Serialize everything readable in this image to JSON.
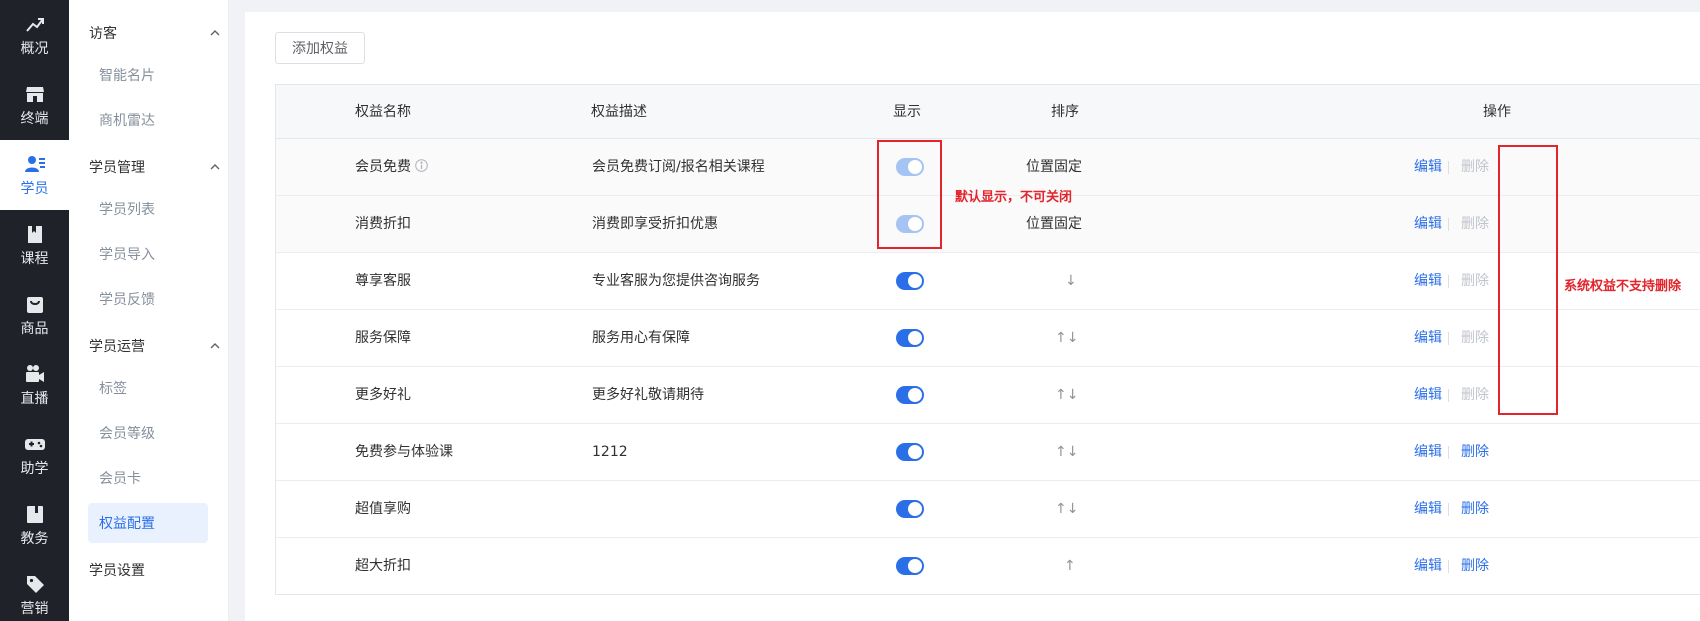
{
  "rail": [
    {
      "label": "概况",
      "icon": "chart-up-icon"
    },
    {
      "label": "终端",
      "icon": "store-icon"
    },
    {
      "label": "学员",
      "icon": "users-icon",
      "active": true
    },
    {
      "label": "课程",
      "icon": "book-icon"
    },
    {
      "label": "商品",
      "icon": "bag-icon"
    },
    {
      "label": "直播",
      "icon": "video-camera-icon"
    },
    {
      "label": "助学",
      "icon": "gamepad-icon"
    },
    {
      "label": "教务",
      "icon": "notebook-icon"
    },
    {
      "label": "营销",
      "icon": "tag-icon"
    }
  ],
  "submenu": {
    "groups": [
      "访客",
      "学员管理",
      "学员运营"
    ],
    "visitor_items": [
      "智能名片",
      "商机雷达"
    ],
    "manage_items": [
      "学员列表",
      "学员导入",
      "学员反馈"
    ],
    "ops_items": [
      "标签",
      "会员等级",
      "会员卡",
      "权益配置"
    ],
    "settings": "学员设置"
  },
  "toolbar": {
    "add_label": "添加权益"
  },
  "table": {
    "headers": [
      "权益名称",
      "权益描述",
      "显示",
      "排序",
      "操作"
    ],
    "rows": [
      {
        "name": "会员免费",
        "desc": "会员免费订阅/报名相关课程",
        "sort": "位置固定",
        "edit": "编辑",
        "delete": "删除"
      },
      {
        "name": "消费折扣",
        "desc": "消费即享受折扣优惠",
        "sort": "位置固定",
        "edit": "编辑",
        "delete": "删除"
      },
      {
        "name": "尊享客服",
        "desc": "专业客服为您提供咨询服务",
        "sort": "↓",
        "edit": "编辑",
        "delete": "删除"
      },
      {
        "name": "服务保障",
        "desc": "服务用心有保障",
        "sort": "↑↓",
        "edit": "编辑",
        "delete": "删除"
      },
      {
        "name": "更多好礼",
        "desc": "更多好礼敬请期待",
        "sort": "↑↓",
        "edit": "编辑",
        "delete": "删除"
      },
      {
        "name": "免费参与体验课",
        "desc": "1212",
        "sort": "↑↓",
        "edit": "编辑",
        "delete": "删除"
      },
      {
        "name": "超值享购",
        "desc": "",
        "sort": "↑↓",
        "edit": "编辑",
        "delete": "删除"
      },
      {
        "name": "超大折扣",
        "desc": "",
        "sort": "↑",
        "edit": "编辑",
        "delete": "删除"
      }
    ]
  },
  "annotations": {
    "display_note": "默认显示，不可关闭",
    "delete_note": "系统权益不支持删除"
  },
  "colors": {
    "accent": "#2b6fe8",
    "annotation": "#e3242b",
    "rail_bg": "#1f2329"
  }
}
